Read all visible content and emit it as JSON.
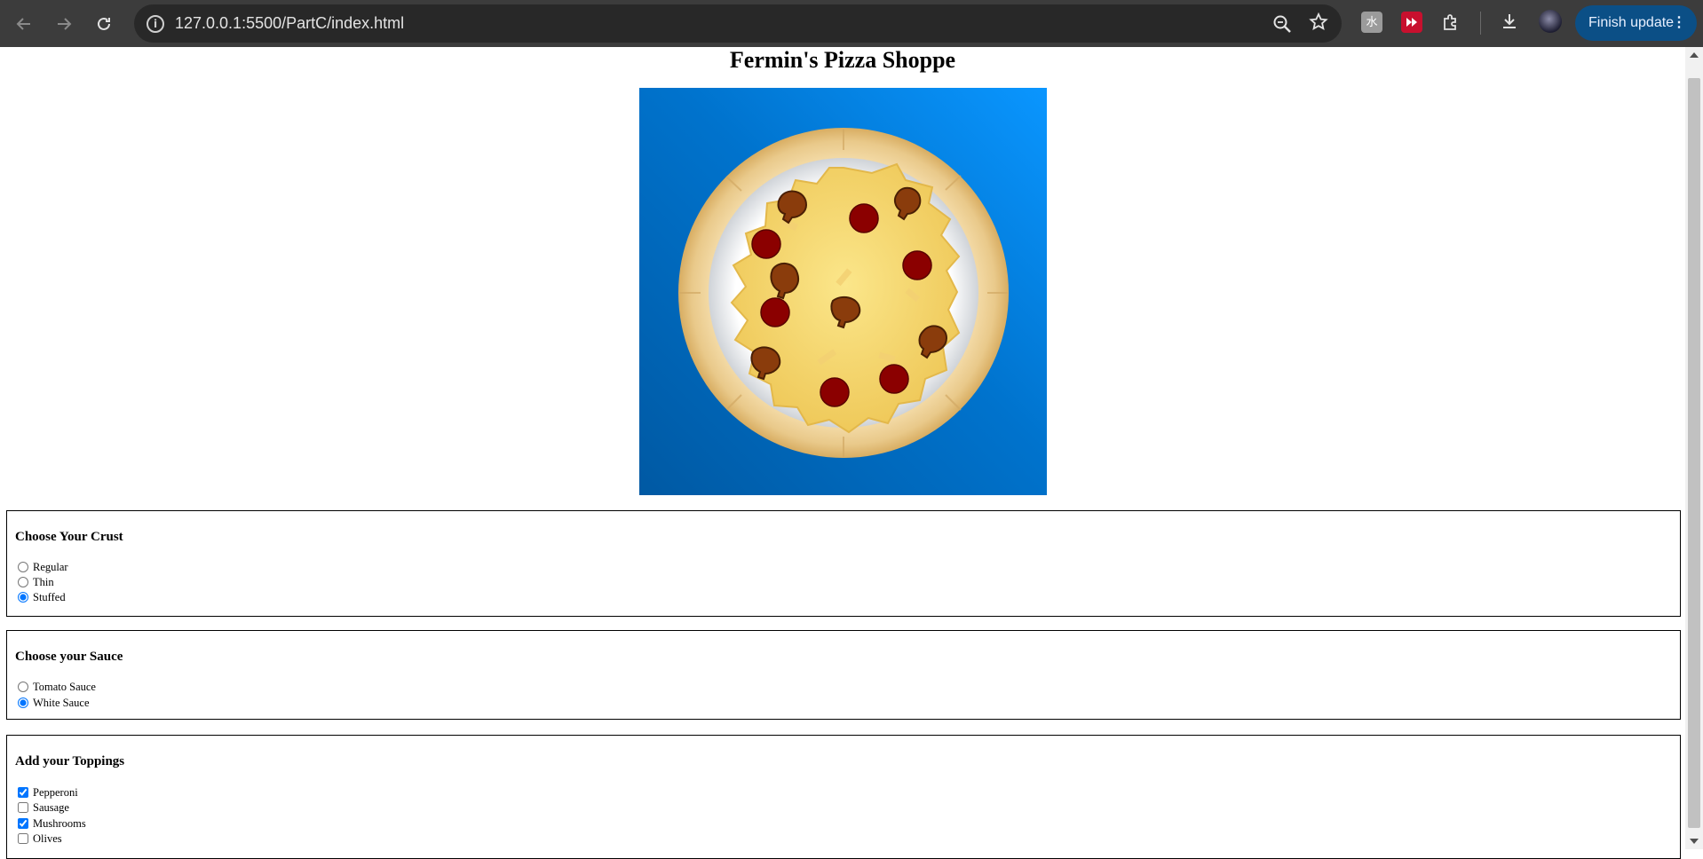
{
  "browser": {
    "url": "127.0.0.1:5500/PartC/index.html",
    "finish_update_label": "Finish update",
    "ext1_letter": "水"
  },
  "page": {
    "title": "Fermin's Pizza Shoppe",
    "pizza_image_alt": "pizza-image"
  },
  "crust": {
    "heading": "Choose Your Crust",
    "options": [
      {
        "label": "Regular",
        "checked": false
      },
      {
        "label": "Thin",
        "checked": false
      },
      {
        "label": "Stuffed",
        "checked": true
      }
    ]
  },
  "sauce": {
    "heading": "Choose your Sauce",
    "options": [
      {
        "label": "Tomato Sauce",
        "checked": false
      },
      {
        "label": "White Sauce",
        "checked": true
      }
    ]
  },
  "toppings": {
    "heading": "Add your Toppings",
    "options": [
      {
        "label": "Pepperoni",
        "checked": true
      },
      {
        "label": "Sausage",
        "checked": false
      },
      {
        "label": "Mushrooms",
        "checked": true
      },
      {
        "label": "Olives",
        "checked": false
      }
    ]
  },
  "colors": {
    "chrome_bg": "#3c3c3c",
    "omnibox_bg": "#282828",
    "finish_update_bg": "#0b4f86",
    "pizza_bg": "#0073cd"
  }
}
